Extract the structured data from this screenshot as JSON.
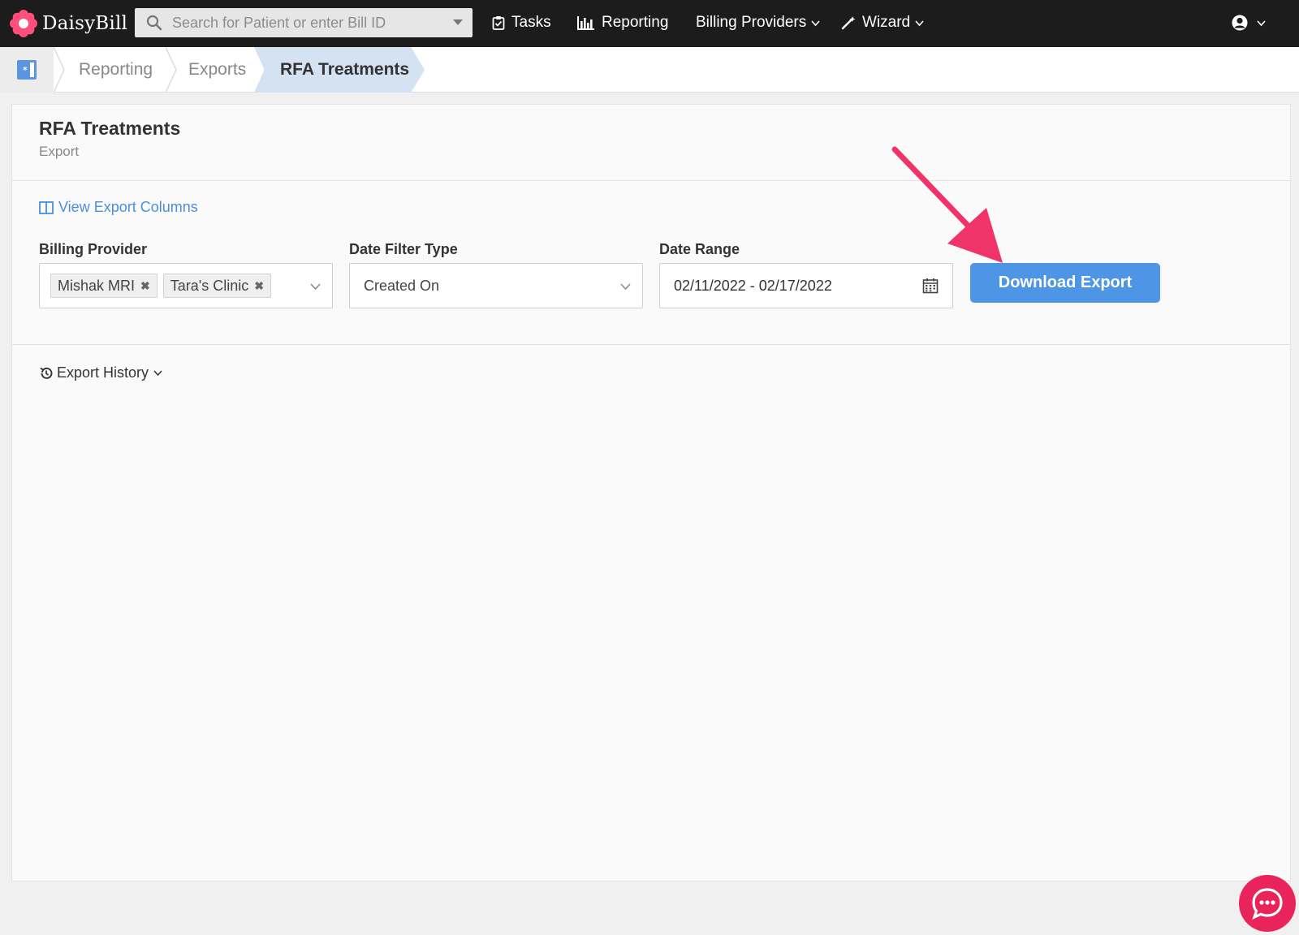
{
  "brand": {
    "name": "DaisyBill"
  },
  "search": {
    "placeholder": "Search for Patient or enter Bill ID"
  },
  "nav": {
    "tasks": "Tasks",
    "reporting": "Reporting",
    "billing_providers": "Billing Providers",
    "wizard": "Wizard"
  },
  "breadcrumb": {
    "items": [
      "Reporting",
      "Exports"
    ],
    "active": "RFA Treatments"
  },
  "page": {
    "title": "RFA Treatments",
    "subtitle": "Export",
    "view_columns_link": "View Export Columns"
  },
  "form": {
    "billing_provider": {
      "label": "Billing Provider",
      "tags": [
        "Mishak MRI",
        "Tara's Clinic"
      ]
    },
    "date_filter_type": {
      "label": "Date Filter Type",
      "value": "Created On"
    },
    "date_range": {
      "label": "Date Range",
      "value": "02/11/2022 - 02/17/2022"
    },
    "download_button": "Download Export"
  },
  "history": {
    "label": "Export History"
  },
  "colors": {
    "topbar": "#1c1c1c",
    "accent": "#4e95e6",
    "link": "#4a8fe0",
    "annotation_arrow": "#f0346a",
    "chat": "#e8245a"
  },
  "icons": {
    "brand": "daisy-flower-icon",
    "search": "search-icon",
    "tasks": "clipboard-check-icon",
    "reporting": "bar-chart-icon",
    "wizard": "magic-wand-icon",
    "user": "user-circle-icon",
    "home": "home-book-icon",
    "columns": "columns-icon",
    "calendar": "calendar-icon",
    "history": "history-icon",
    "chat": "chat-bubble-icon"
  }
}
